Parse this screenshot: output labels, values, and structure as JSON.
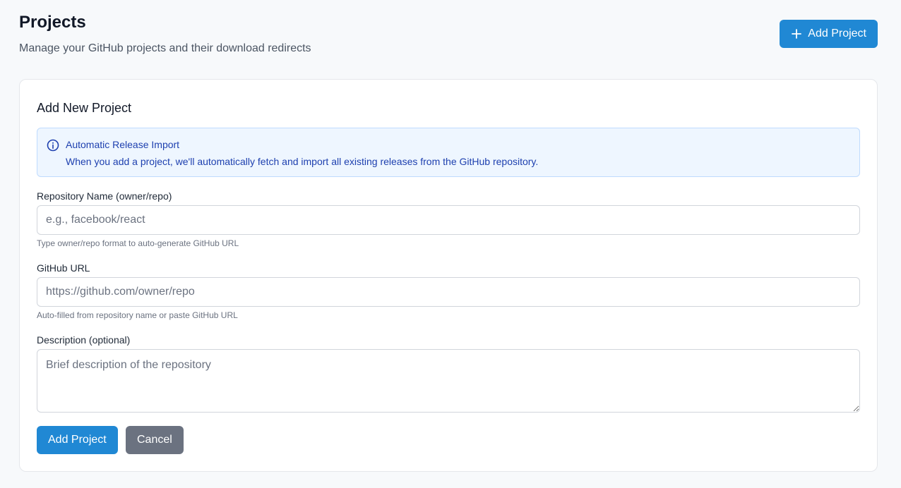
{
  "header": {
    "title": "Projects",
    "subtitle": "Manage your GitHub projects and their download redirects",
    "add_button_label": "Add Project",
    "add_button_icon": "plus-icon"
  },
  "form": {
    "title": "Add New Project",
    "info": {
      "icon": "info-icon",
      "title": "Automatic Release Import",
      "text": "When you add a project, we'll automatically fetch and import all existing releases from the GitHub repository."
    },
    "repository": {
      "label": "Repository Name (owner/repo)",
      "placeholder": "e.g., facebook/react",
      "value": "",
      "help": "Type owner/repo format to auto-generate GitHub URL"
    },
    "github_url": {
      "label": "GitHub URL",
      "placeholder": "https://github.com/owner/repo",
      "value": "",
      "help": "Auto-filled from repository name or paste GitHub URL"
    },
    "description": {
      "label": "Description (optional)",
      "placeholder": "Brief description of the repository",
      "value": ""
    },
    "submit_label": "Add Project",
    "cancel_label": "Cancel"
  },
  "colors": {
    "primary": "#2088d4",
    "secondary": "#6b7280",
    "info_background": "#eef6ff",
    "info_text": "#1e40af",
    "page_background": "#f7f9fb"
  }
}
